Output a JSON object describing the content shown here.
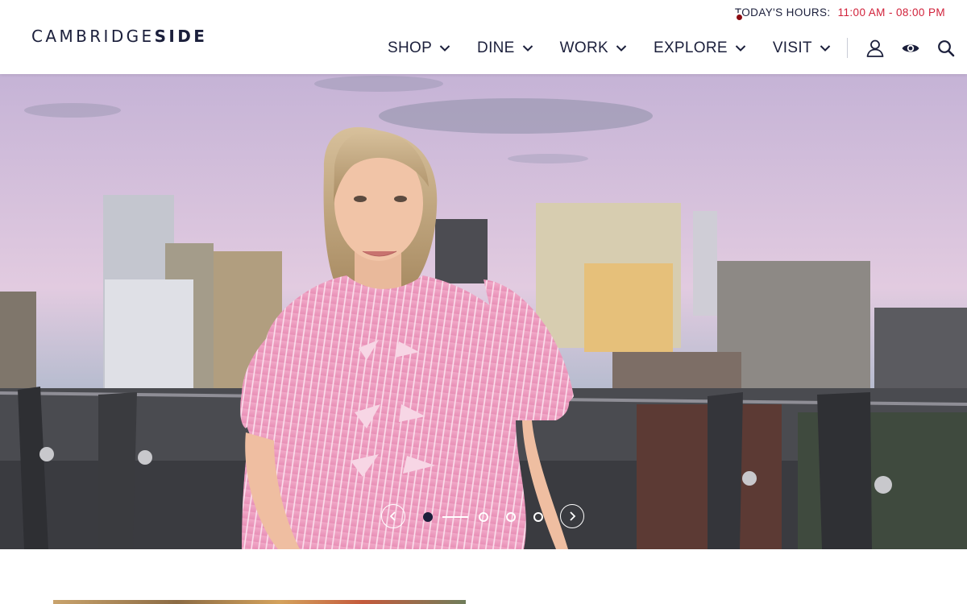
{
  "brand": {
    "logo_light": "CAMBRIDGE",
    "logo_bold": "SIDE"
  },
  "hours": {
    "label": "TODAY'S HOURS:",
    "time": "11:00 AM - 08:00 PM",
    "dot_color": "#8b0c12",
    "time_color": "#d1213a"
  },
  "nav": {
    "items": [
      {
        "label": "SHOP"
      },
      {
        "label": "DINE"
      },
      {
        "label": "WORK"
      },
      {
        "label": "EXPLORE"
      },
      {
        "label": "VISIT"
      }
    ]
  },
  "utility_icons": [
    "user-icon",
    "eye-icon",
    "search-icon"
  ],
  "carousel": {
    "slide_count": 4,
    "active_slide": 1
  },
  "colors": {
    "brand_navy": "#1b1f3b",
    "accent_red": "#d1213a"
  }
}
